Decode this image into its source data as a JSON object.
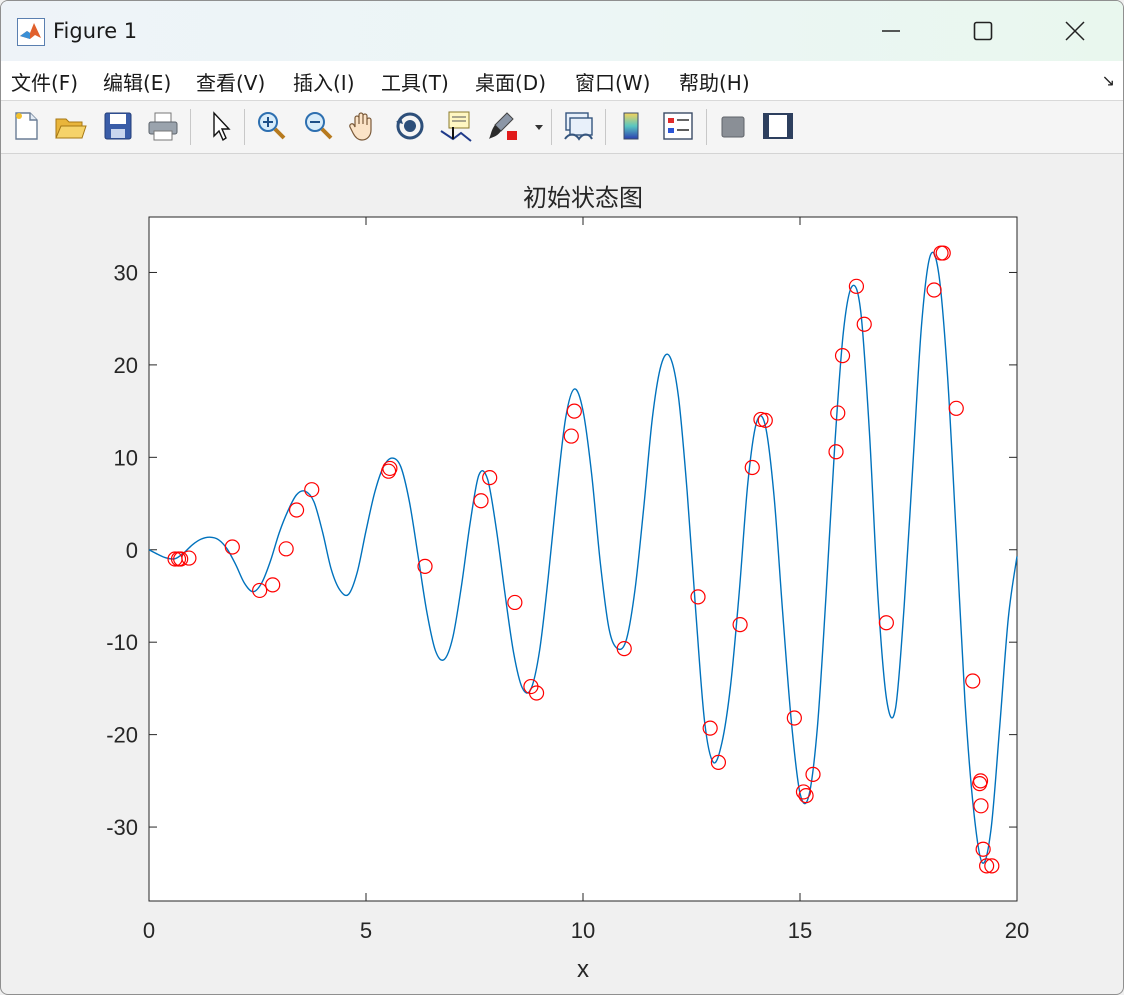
{
  "window": {
    "title": "Figure 1"
  },
  "menu": {
    "items": [
      "文件(F)",
      "编辑(E)",
      "查看(V)",
      "插入(I)",
      "工具(T)",
      "桌面(D)",
      "窗口(W)",
      "帮助(H)"
    ]
  },
  "toolbar": {
    "icons": [
      "new-figure-icon",
      "open-file-icon",
      "save-icon",
      "print-icon",
      "pointer-icon",
      "zoom-in-icon",
      "zoom-out-icon",
      "pan-icon",
      "rotate-3d-icon",
      "data-cursor-icon",
      "brush-icon",
      "link-plot-icon",
      "colorbar-icon",
      "legend-icon",
      "hide-plot-tools-icon",
      "show-plot-tools-icon"
    ]
  },
  "chart_data": {
    "type": "line",
    "title": "初始状态图",
    "xlabel": "x",
    "ylabel": "",
    "xlim": [
      0,
      20
    ],
    "ylim": [
      -38,
      36
    ],
    "xticks": [
      0,
      5,
      10,
      15,
      20
    ],
    "yticks": [
      -30,
      -20,
      -10,
      0,
      10,
      20,
      30
    ],
    "xtick_labels": [
      "0",
      "5",
      "10",
      "15",
      "20"
    ],
    "ytick_labels": [
      "-30",
      "-20",
      "-10",
      "0",
      "10",
      "20",
      "30"
    ],
    "grid": false,
    "curve_color": "#0072bd",
    "marker_color": "#ff0000",
    "series": [
      {
        "type": "line",
        "x": [
          0,
          0.2,
          0.4,
          0.6,
          0.8,
          1.0,
          1.2,
          1.4,
          1.6,
          1.8,
          2.0,
          2.2,
          2.4,
          2.6,
          2.8,
          3.0,
          3.2,
          3.4,
          3.6,
          3.8,
          4.0,
          4.2,
          4.4,
          4.6,
          4.8,
          5.0,
          5.2,
          5.4,
          5.6,
          5.8,
          6.0,
          6.2,
          6.4,
          6.6,
          6.8,
          7.0,
          7.2,
          7.4,
          7.6,
          7.8,
          8.0,
          8.2,
          8.4,
          8.6,
          8.8,
          9.0,
          9.2,
          9.4,
          9.6,
          9.8,
          10.0,
          10.2,
          10.4,
          10.6,
          10.8,
          11.0,
          11.2,
          11.4,
          11.6,
          11.8,
          12.0,
          12.2,
          12.4,
          12.6,
          12.8,
          13.0,
          13.2,
          13.4,
          13.6,
          13.8,
          14.0,
          14.2,
          14.4,
          14.6,
          14.8,
          15.0,
          15.2,
          15.4,
          15.6,
          15.8,
          16.0,
          16.2,
          16.4,
          16.6,
          16.8,
          17.0,
          17.2,
          17.4,
          17.6,
          17.8,
          18.0,
          18.2,
          18.4,
          18.6,
          18.8,
          19.0,
          19.2,
          19.4,
          19.6,
          19.8,
          20.0
        ],
        "y": [
          0.0,
          -0.49,
          -0.89,
          -0.97,
          -0.35,
          0.54,
          1.15,
          1.36,
          1.09,
          0.09,
          -1.63,
          -3.62,
          -4.54,
          -3.56,
          -1.19,
          1.83,
          4.2,
          5.95,
          6.33,
          5.19,
          1.9,
          -2.13,
          -4.37,
          -4.81,
          -2.4,
          2.05,
          6.19,
          8.95,
          9.92,
          9.0,
          5.2,
          -0.67,
          -6.69,
          -10.92,
          -11.88,
          -9.48,
          -3.89,
          2.91,
          8.08,
          7.66,
          2.33,
          -4.67,
          -11.11,
          -14.93,
          -15.07,
          -10.89,
          -2.93,
          6.33,
          14.25,
          17.39,
          15.05,
          8.15,
          -1.47,
          -8.56,
          -10.71,
          -9.71,
          -4.25,
          4.59,
          14.32,
          19.98,
          20.9,
          16.54,
          6.27,
          -6.79,
          -18.52,
          -22.98,
          -20.89,
          -14.7,
          -4.59,
          7.31,
          13.79,
          13.44,
          5.91,
          -6.74,
          -18.55,
          -26.33,
          -26.68,
          -19.25,
          -4.93,
          11.21,
          23.58,
          28.5,
          25.75,
          12.69,
          -5.36,
          -16.34,
          -17.19,
          -6.1,
          9.12,
          24.28,
          31.8,
          29.76,
          18.77,
          1.55,
          -16.31,
          -28.13,
          -33.86,
          -30.3,
          -19.24,
          -7.38,
          -0.72
        ]
      },
      {
        "type": "scatter",
        "marker": "circle",
        "x": [
          0.6,
          0.68,
          0.73,
          0.92,
          1.92,
          2.55,
          2.85,
          3.16,
          3.4,
          3.75,
          5.52,
          5.55,
          6.36,
          7.65,
          7.85,
          8.43,
          8.8,
          8.93,
          9.73,
          9.8,
          10.95,
          12.65,
          12.93,
          13.12,
          13.62,
          13.9,
          14.1,
          14.2,
          14.87,
          15.08,
          15.14,
          15.3,
          15.83,
          15.87,
          15.98,
          16.3,
          16.48,
          16.99,
          18.09,
          18.25,
          18.3,
          18.6,
          18.98,
          19.14,
          19.16,
          19.17,
          19.22,
          19.3,
          19.42
        ],
        "y": [
          -1.0,
          -1.0,
          -1.0,
          -0.9,
          0.3,
          -4.4,
          -3.8,
          0.1,
          4.3,
          6.5,
          8.5,
          8.8,
          -1.8,
          5.3,
          7.8,
          -5.7,
          -14.8,
          -15.5,
          12.3,
          15.0,
          -10.7,
          -5.1,
          -19.3,
          -23.0,
          -8.1,
          8.9,
          14.1,
          14.0,
          -18.2,
          -26.2,
          -26.6,
          -24.3,
          10.6,
          14.8,
          21.0,
          28.5,
          24.4,
          -7.9,
          28.1,
          32.1,
          32.1,
          15.3,
          -14.2,
          -25.3,
          -25.0,
          -27.7,
          -32.4,
          -34.2,
          -34.2
        ]
      }
    ]
  }
}
